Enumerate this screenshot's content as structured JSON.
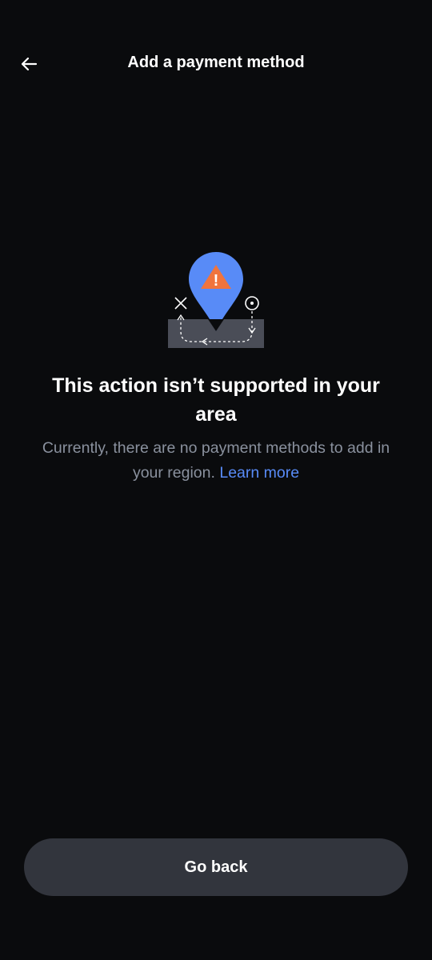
{
  "header": {
    "title": "Add a payment method",
    "back_icon": "arrow-left-icon"
  },
  "illustration": {
    "icon": "location-warning-icon",
    "pin_color": "#588bf7",
    "warning_color": "#f0743d",
    "warning_mark": "!"
  },
  "main": {
    "headline": "This action isn’t supported in your area",
    "subtext": "Currently, there are no payment methods to add in your region.",
    "learn_more_label": "Learn more"
  },
  "footer": {
    "go_back_label": "Go back"
  },
  "colors": {
    "background": "#0a0b0d",
    "button_bg": "#32353d",
    "link": "#588bf7",
    "muted_text": "#8a919e"
  }
}
